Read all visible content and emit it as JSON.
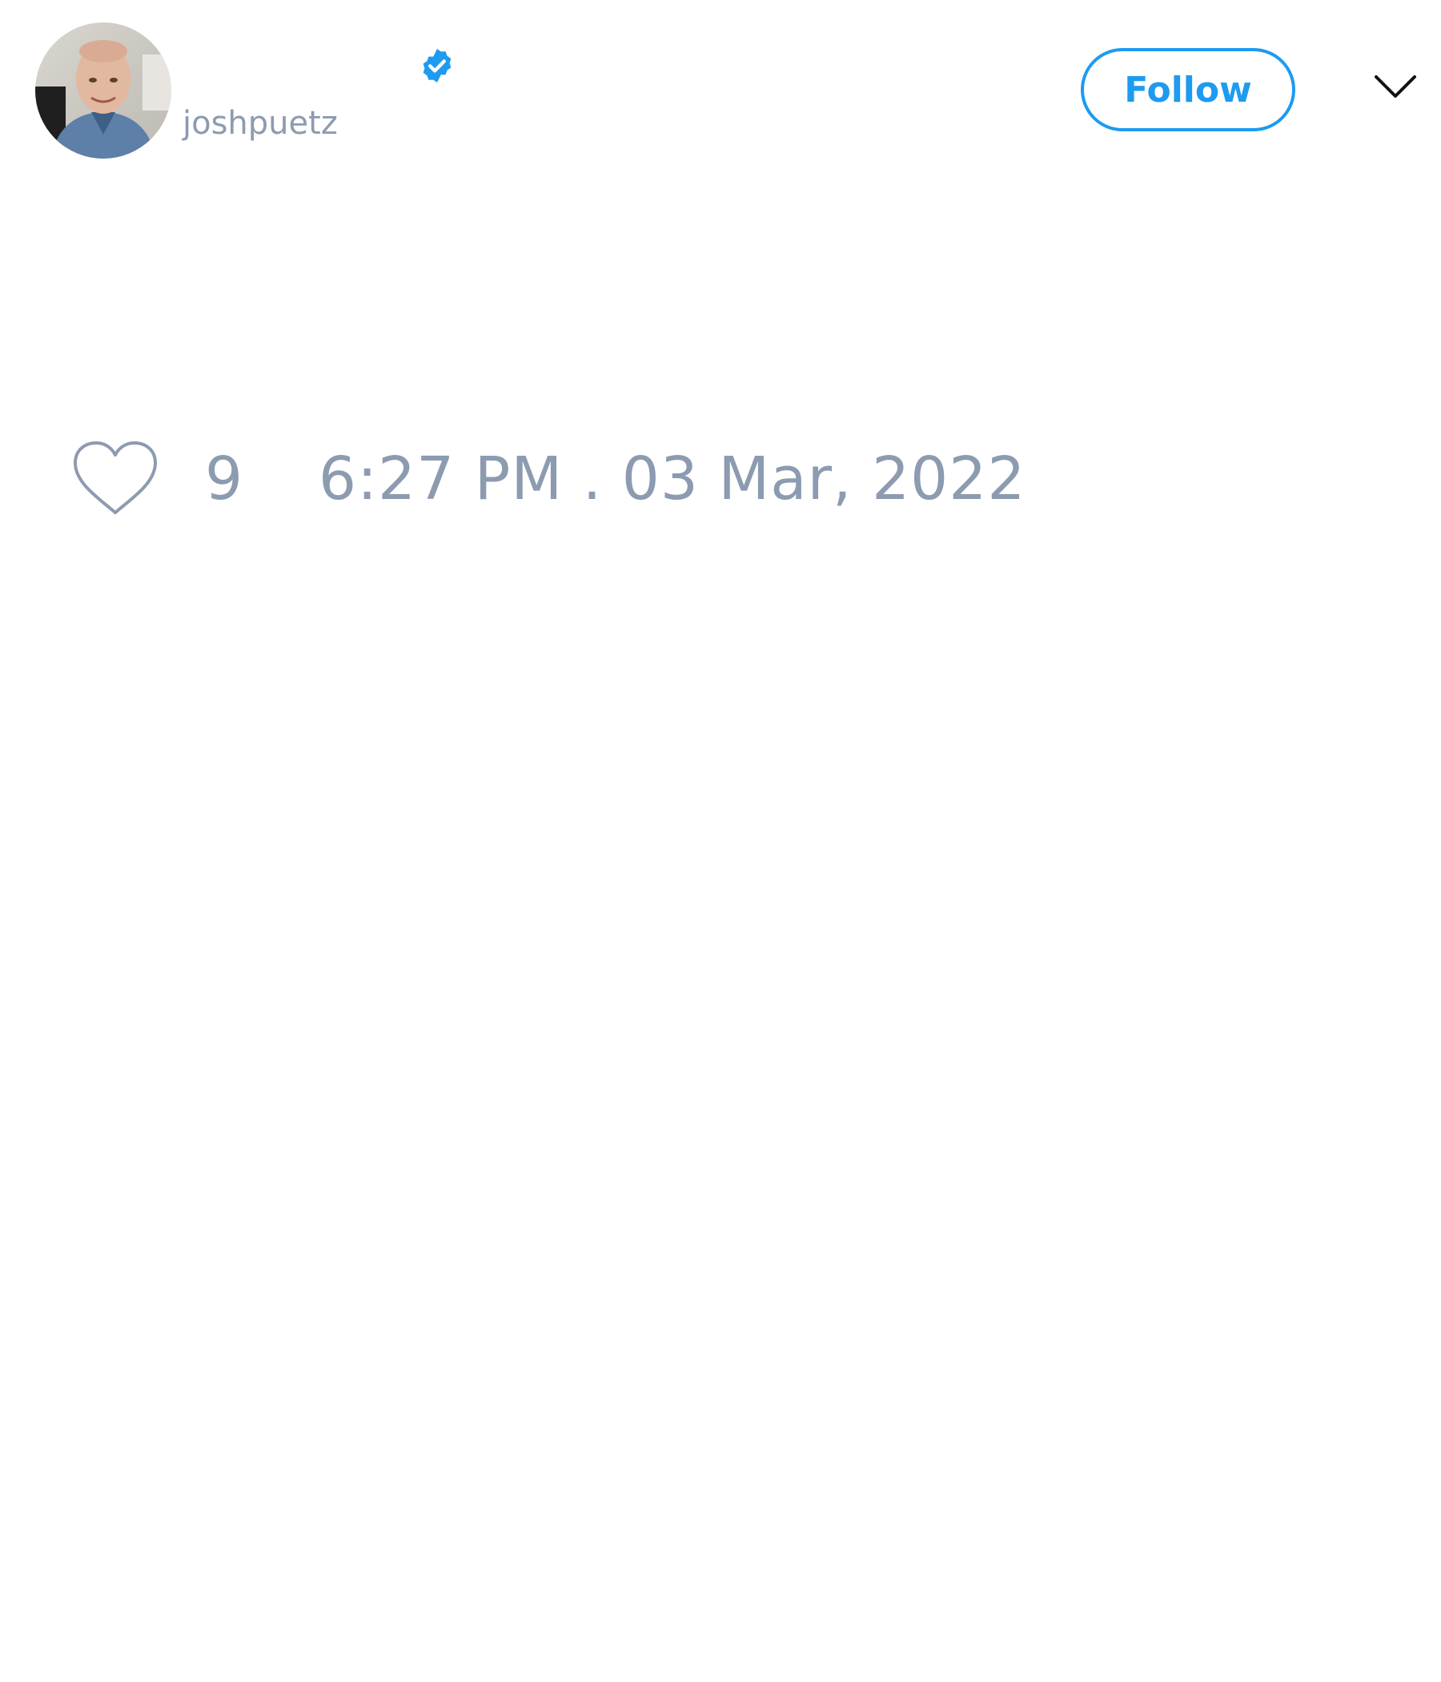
{
  "author": {
    "display_name": "",
    "handle": "joshpuetz",
    "verified": true,
    "avatar_icon": "profile-photo"
  },
  "actions": {
    "follow_label": "Follow",
    "more_icon": "chevron-down-icon"
  },
  "stats": {
    "like_icon": "heart-icon",
    "like_count": "9",
    "timestamp": "6:27 PM . 03 Mar, 2022"
  },
  "colors": {
    "accent": "#1d9bf0",
    "muted_text": "#8c9bb0",
    "background": "#ffffff"
  }
}
